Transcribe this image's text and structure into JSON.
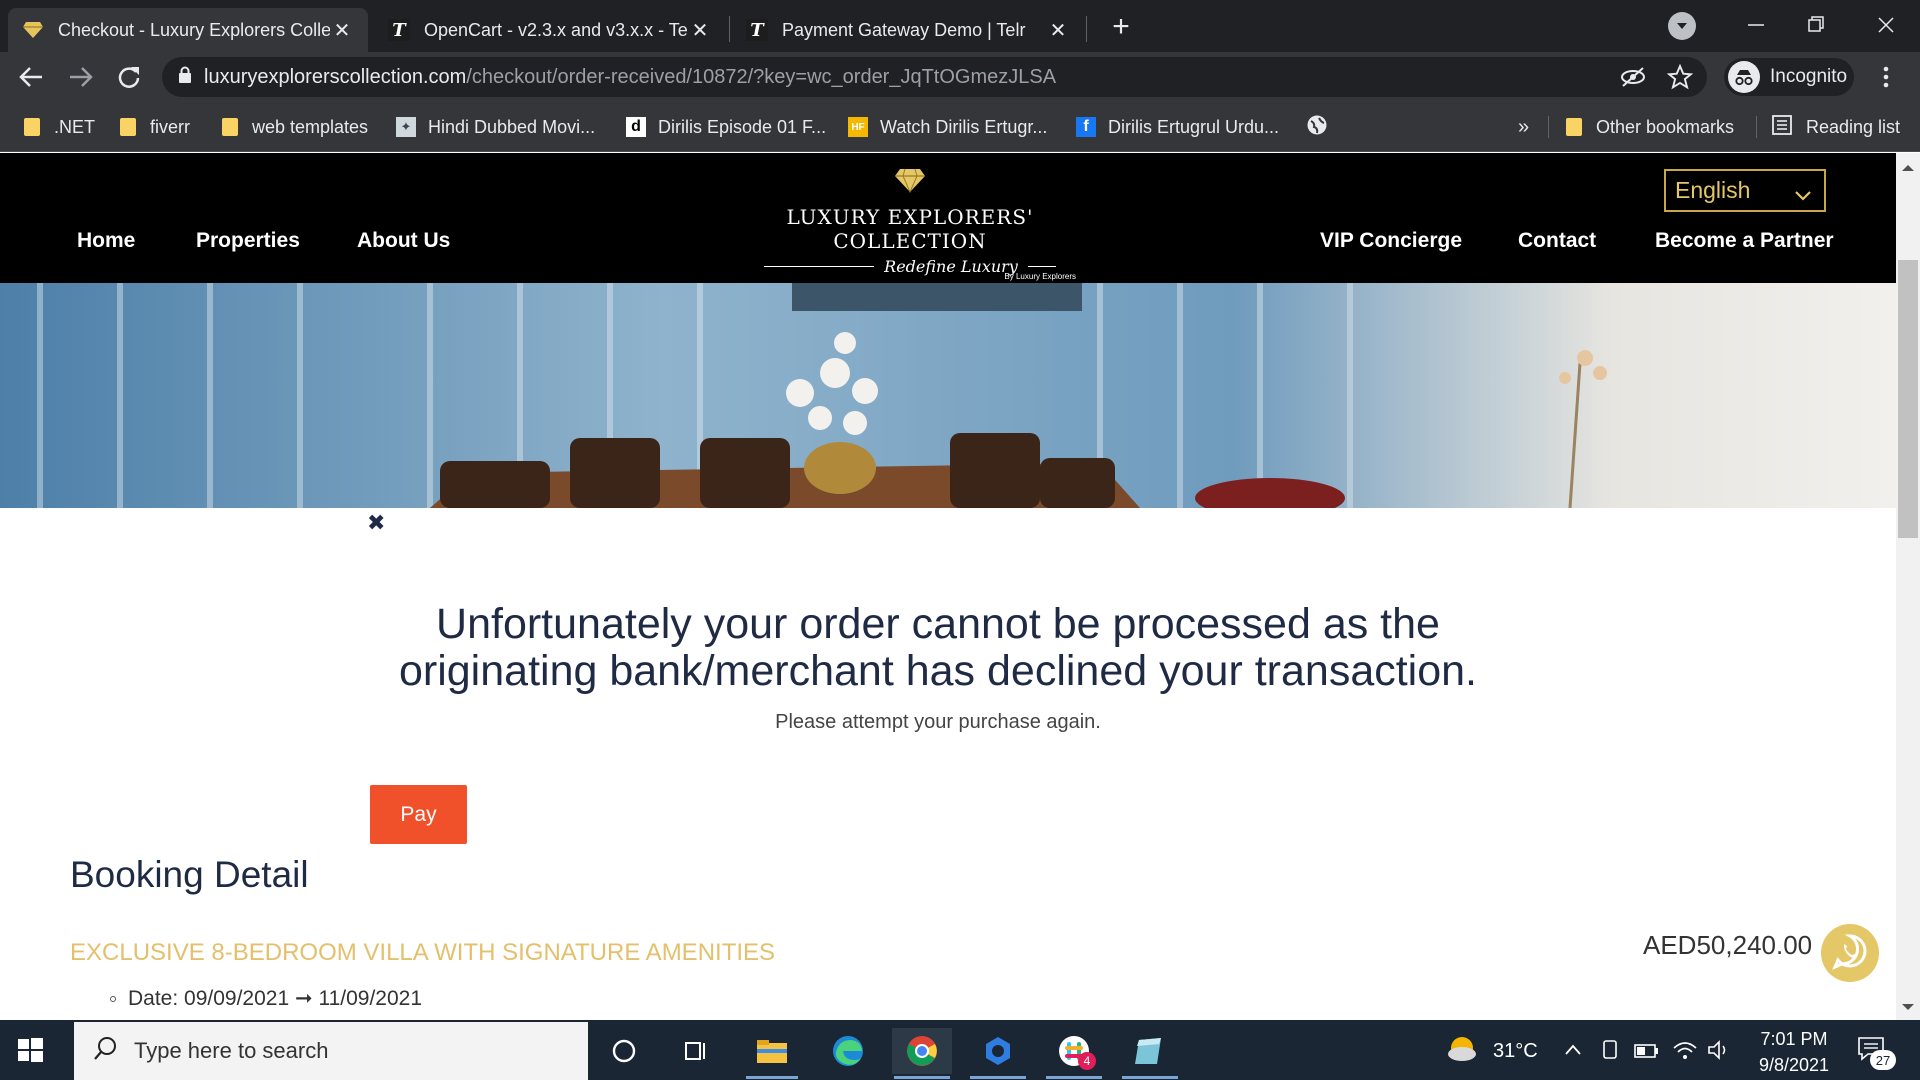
{
  "browser": {
    "tabs": [
      {
        "title": "Checkout - Luxury Explorers Colle",
        "favicon": "diamond-icon",
        "active": true
      },
      {
        "title": "OpenCart - v2.3.x and v3.x.x - Tel",
        "favicon": "telr-t-icon",
        "active": false
      },
      {
        "title": "Payment Gateway Demo | Telr",
        "favicon": "telr-t-icon",
        "active": false
      }
    ],
    "url_host": "luxuryexplorerscollection.com",
    "url_path": "/checkout/order-received/10872/?key=wc_order_JqTtOGmezJLSA",
    "incognito_label": "Incognito",
    "bookmarks": [
      {
        "label": ".NET",
        "icon": "folder-icon"
      },
      {
        "label": "fiverr",
        "icon": "folder-icon"
      },
      {
        "label": "web templates",
        "icon": "folder-icon"
      },
      {
        "label": "Hindi Dubbed Movi...",
        "icon": "site-icon"
      },
      {
        "label": "Dirilis Episode 01 F...",
        "icon": "d-icon"
      },
      {
        "label": "Watch Dirilis Ertugr...",
        "icon": "hf-icon"
      },
      {
        "label": "Dirilis Ertugrul Urdu...",
        "icon": "facebook-icon"
      }
    ],
    "bookmarks_overflow": "»",
    "other_bookmarks": "Other bookmarks",
    "reading_list": "Reading list"
  },
  "site": {
    "nav_left": [
      "Home",
      "Properties",
      "About Us"
    ],
    "nav_right": [
      "VIP Concierge",
      "Contact",
      "Become a Partner"
    ],
    "language": "English",
    "logo_title": "LUXURY EXPLORERS' COLLECTION",
    "logo_script": "Redefine Luxury",
    "logo_sub": "By Luxury Explorers"
  },
  "message": {
    "close_glyph": "✖",
    "headline_line1": "Unfortunately your order cannot be processed as the",
    "headline_line2": "originating bank/merchant has declined your transaction.",
    "subtext": "Please attempt your purchase again.",
    "pay_label": "Pay"
  },
  "booking": {
    "title": "Booking Detail",
    "item_name": "EXCLUSIVE 8-BEDROOM VILLA WITH SIGNATURE AMENITIES",
    "price": "AED50,240.00",
    "date_label": "Date:",
    "date_from": "09/09/2021",
    "date_arrow": "➞",
    "date_to": "11/09/2021"
  },
  "taskbar": {
    "search_placeholder": "Type here to search",
    "temperature": "31°C",
    "time": "7:01 PM",
    "date": "9/8/2021",
    "notifications": "27",
    "slack_badge": "4"
  },
  "colors": {
    "accent_gold": "#c6a74a",
    "pay_button": "#f0512b",
    "headline": "#1f2a44"
  }
}
